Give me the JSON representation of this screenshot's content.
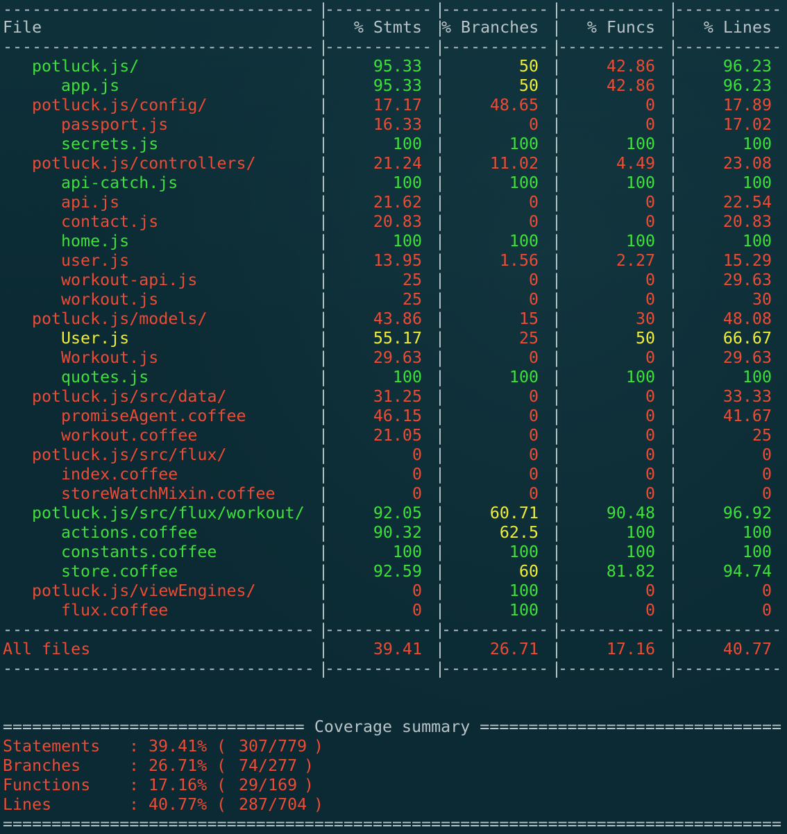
{
  "header": {
    "file": "File",
    "stmts": "% Stmts",
    "branches": "% Branches",
    "funcs": "% Funcs",
    "lines": "% Lines"
  },
  "dash_line": "-------------------------------|-----------|-----------|-----------|-----------|",
  "rows": [
    {
      "file": "potluck.js/",
      "indent": 1,
      "file_color": "green",
      "stmts": "95.33",
      "stmts_color": "green",
      "branches": "50",
      "branches_color": "yellow",
      "funcs": "42.86",
      "funcs_color": "red",
      "lines": "96.23",
      "lines_color": "green"
    },
    {
      "file": "app.js",
      "indent": 2,
      "file_color": "green",
      "stmts": "95.33",
      "stmts_color": "green",
      "branches": "50",
      "branches_color": "yellow",
      "funcs": "42.86",
      "funcs_color": "red",
      "lines": "96.23",
      "lines_color": "green"
    },
    {
      "file": "potluck.js/config/",
      "indent": 1,
      "file_color": "red",
      "stmts": "17.17",
      "stmts_color": "red",
      "branches": "48.65",
      "branches_color": "red",
      "funcs": "0",
      "funcs_color": "red",
      "lines": "17.89",
      "lines_color": "red"
    },
    {
      "file": "passport.js",
      "indent": 2,
      "file_color": "red",
      "stmts": "16.33",
      "stmts_color": "red",
      "branches": "0",
      "branches_color": "red",
      "funcs": "0",
      "funcs_color": "red",
      "lines": "17.02",
      "lines_color": "red"
    },
    {
      "file": "secrets.js",
      "indent": 2,
      "file_color": "green",
      "stmts": "100",
      "stmts_color": "green",
      "branches": "100",
      "branches_color": "green",
      "funcs": "100",
      "funcs_color": "green",
      "lines": "100",
      "lines_color": "green"
    },
    {
      "file": "potluck.js/controllers/",
      "indent": 1,
      "file_color": "red",
      "stmts": "21.24",
      "stmts_color": "red",
      "branches": "11.02",
      "branches_color": "red",
      "funcs": "4.49",
      "funcs_color": "red",
      "lines": "23.08",
      "lines_color": "red"
    },
    {
      "file": "api-catch.js",
      "indent": 2,
      "file_color": "green",
      "stmts": "100",
      "stmts_color": "green",
      "branches": "100",
      "branches_color": "green",
      "funcs": "100",
      "funcs_color": "green",
      "lines": "100",
      "lines_color": "green"
    },
    {
      "file": "api.js",
      "indent": 2,
      "file_color": "red",
      "stmts": "21.62",
      "stmts_color": "red",
      "branches": "0",
      "branches_color": "red",
      "funcs": "0",
      "funcs_color": "red",
      "lines": "22.54",
      "lines_color": "red"
    },
    {
      "file": "contact.js",
      "indent": 2,
      "file_color": "red",
      "stmts": "20.83",
      "stmts_color": "red",
      "branches": "0",
      "branches_color": "red",
      "funcs": "0",
      "funcs_color": "red",
      "lines": "20.83",
      "lines_color": "red"
    },
    {
      "file": "home.js",
      "indent": 2,
      "file_color": "green",
      "stmts": "100",
      "stmts_color": "green",
      "branches": "100",
      "branches_color": "green",
      "funcs": "100",
      "funcs_color": "green",
      "lines": "100",
      "lines_color": "green"
    },
    {
      "file": "user.js",
      "indent": 2,
      "file_color": "red",
      "stmts": "13.95",
      "stmts_color": "red",
      "branches": "1.56",
      "branches_color": "red",
      "funcs": "2.27",
      "funcs_color": "red",
      "lines": "15.29",
      "lines_color": "red"
    },
    {
      "file": "workout-api.js",
      "indent": 2,
      "file_color": "red",
      "stmts": "25",
      "stmts_color": "red",
      "branches": "0",
      "branches_color": "red",
      "funcs": "0",
      "funcs_color": "red",
      "lines": "29.63",
      "lines_color": "red"
    },
    {
      "file": "workout.js",
      "indent": 2,
      "file_color": "red",
      "stmts": "25",
      "stmts_color": "red",
      "branches": "0",
      "branches_color": "red",
      "funcs": "0",
      "funcs_color": "red",
      "lines": "30",
      "lines_color": "red"
    },
    {
      "file": "potluck.js/models/",
      "indent": 1,
      "file_color": "red",
      "stmts": "43.86",
      "stmts_color": "red",
      "branches": "15",
      "branches_color": "red",
      "funcs": "30",
      "funcs_color": "red",
      "lines": "48.08",
      "lines_color": "red"
    },
    {
      "file": "User.js",
      "indent": 2,
      "file_color": "yellow",
      "stmts": "55.17",
      "stmts_color": "yellow",
      "branches": "25",
      "branches_color": "red",
      "funcs": "50",
      "funcs_color": "yellow",
      "lines": "66.67",
      "lines_color": "yellow"
    },
    {
      "file": "Workout.js",
      "indent": 2,
      "file_color": "red",
      "stmts": "29.63",
      "stmts_color": "red",
      "branches": "0",
      "branches_color": "red",
      "funcs": "0",
      "funcs_color": "red",
      "lines": "29.63",
      "lines_color": "red"
    },
    {
      "file": "quotes.js",
      "indent": 2,
      "file_color": "green",
      "stmts": "100",
      "stmts_color": "green",
      "branches": "100",
      "branches_color": "green",
      "funcs": "100",
      "funcs_color": "green",
      "lines": "100",
      "lines_color": "green"
    },
    {
      "file": "potluck.js/src/data/",
      "indent": 1,
      "file_color": "red",
      "stmts": "31.25",
      "stmts_color": "red",
      "branches": "0",
      "branches_color": "red",
      "funcs": "0",
      "funcs_color": "red",
      "lines": "33.33",
      "lines_color": "red"
    },
    {
      "file": "promiseAgent.coffee",
      "indent": 2,
      "file_color": "red",
      "stmts": "46.15",
      "stmts_color": "red",
      "branches": "0",
      "branches_color": "red",
      "funcs": "0",
      "funcs_color": "red",
      "lines": "41.67",
      "lines_color": "red"
    },
    {
      "file": "workout.coffee",
      "indent": 2,
      "file_color": "red",
      "stmts": "21.05",
      "stmts_color": "red",
      "branches": "0",
      "branches_color": "red",
      "funcs": "0",
      "funcs_color": "red",
      "lines": "25",
      "lines_color": "red"
    },
    {
      "file": "potluck.js/src/flux/",
      "indent": 1,
      "file_color": "red",
      "stmts": "0",
      "stmts_color": "red",
      "branches": "0",
      "branches_color": "red",
      "funcs": "0",
      "funcs_color": "red",
      "lines": "0",
      "lines_color": "red"
    },
    {
      "file": "index.coffee",
      "indent": 2,
      "file_color": "red",
      "stmts": "0",
      "stmts_color": "red",
      "branches": "0",
      "branches_color": "red",
      "funcs": "0",
      "funcs_color": "red",
      "lines": "0",
      "lines_color": "red"
    },
    {
      "file": "storeWatchMixin.coffee",
      "indent": 2,
      "file_color": "red",
      "stmts": "0",
      "stmts_color": "red",
      "branches": "0",
      "branches_color": "red",
      "funcs": "0",
      "funcs_color": "red",
      "lines": "0",
      "lines_color": "red"
    },
    {
      "file": "potluck.js/src/flux/workout/",
      "indent": 1,
      "file_color": "green",
      "stmts": "92.05",
      "stmts_color": "green",
      "branches": "60.71",
      "branches_color": "yellow",
      "funcs": "90.48",
      "funcs_color": "green",
      "lines": "96.92",
      "lines_color": "green"
    },
    {
      "file": "actions.coffee",
      "indent": 2,
      "file_color": "green",
      "stmts": "90.32",
      "stmts_color": "green",
      "branches": "62.5",
      "branches_color": "yellow",
      "funcs": "100",
      "funcs_color": "green",
      "lines": "100",
      "lines_color": "green"
    },
    {
      "file": "constants.coffee",
      "indent": 2,
      "file_color": "green",
      "stmts": "100",
      "stmts_color": "green",
      "branches": "100",
      "branches_color": "green",
      "funcs": "100",
      "funcs_color": "green",
      "lines": "100",
      "lines_color": "green"
    },
    {
      "file": "store.coffee",
      "indent": 2,
      "file_color": "green",
      "stmts": "92.59",
      "stmts_color": "green",
      "branches": "60",
      "branches_color": "yellow",
      "funcs": "81.82",
      "funcs_color": "green",
      "lines": "94.74",
      "lines_color": "green"
    },
    {
      "file": "potluck.js/viewEngines/",
      "indent": 1,
      "file_color": "red",
      "stmts": "0",
      "stmts_color": "red",
      "branches": "100",
      "branches_color": "green",
      "funcs": "0",
      "funcs_color": "red",
      "lines": "0",
      "lines_color": "red"
    },
    {
      "file": "flux.coffee",
      "indent": 2,
      "file_color": "red",
      "stmts": "0",
      "stmts_color": "red",
      "branches": "100",
      "branches_color": "green",
      "funcs": "0",
      "funcs_color": "red",
      "lines": "0",
      "lines_color": "red"
    }
  ],
  "totals": {
    "file": "All files",
    "stmts": "39.41",
    "branches": "26.71",
    "funcs": "17.16",
    "lines": "40.77",
    "color": "red"
  },
  "summary": {
    "title_line": "=============================== Coverage summary ===============================",
    "bottom_line": "================================================================================",
    "items": [
      {
        "label": "Statements",
        "value": "39.41%",
        "counts": "307/779"
      },
      {
        "label": "Branches",
        "value": "26.71%",
        "counts": "74/277"
      },
      {
        "label": "Functions",
        "value": "17.16%",
        "counts": "29/169"
      },
      {
        "label": "Lines",
        "value": "40.77%",
        "counts": "287/704"
      }
    ]
  },
  "colors": {
    "background": "#0b2a33",
    "green": "#3ee03a",
    "red": "#ee4b35",
    "yellow": "#f0ee3a",
    "neutral": "#b8c4c8"
  }
}
